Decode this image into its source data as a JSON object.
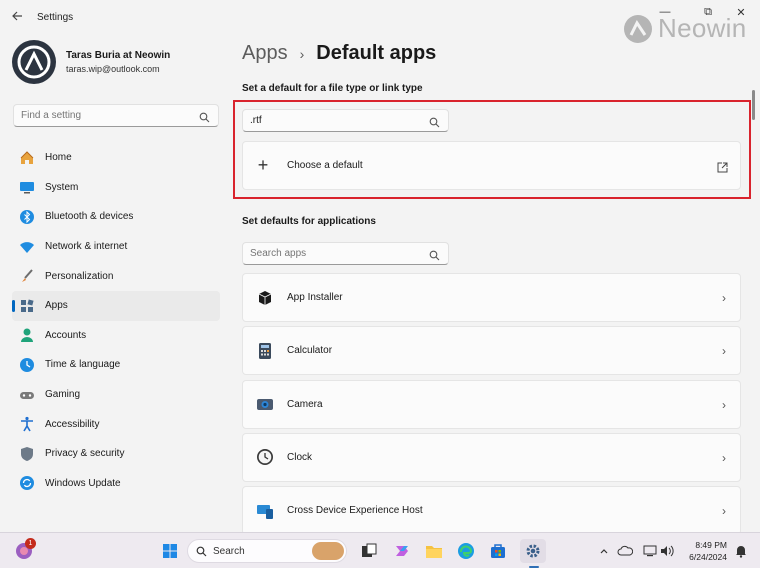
{
  "window": {
    "title": "Settings",
    "back_icon": "back-arrow-icon",
    "minimize": "—",
    "maximize": "⧉",
    "close": "✕"
  },
  "watermark": {
    "text": "Neowin",
    "icon": "neowin-logo-icon"
  },
  "profile": {
    "name": "Taras Buria at Neowin",
    "email": "taras.wip@outlook.com"
  },
  "sidebar": {
    "search_placeholder": "Find a setting",
    "items": [
      {
        "label": "Home",
        "icon": "home-icon",
        "active": false
      },
      {
        "label": "System",
        "icon": "system-icon",
        "active": false
      },
      {
        "label": "Bluetooth & devices",
        "icon": "bluetooth-icon",
        "active": false
      },
      {
        "label": "Network & internet",
        "icon": "network-icon",
        "active": false
      },
      {
        "label": "Personalization",
        "icon": "brush-icon",
        "active": false
      },
      {
        "label": "Apps",
        "icon": "apps-icon",
        "active": true
      },
      {
        "label": "Accounts",
        "icon": "accounts-icon",
        "active": false
      },
      {
        "label": "Time & language",
        "icon": "time-language-icon",
        "active": false
      },
      {
        "label": "Gaming",
        "icon": "gaming-icon",
        "active": false
      },
      {
        "label": "Accessibility",
        "icon": "accessibility-icon",
        "active": false
      },
      {
        "label": "Privacy & security",
        "icon": "shield-icon",
        "active": false
      },
      {
        "label": "Windows Update",
        "icon": "update-icon",
        "active": false
      }
    ]
  },
  "main": {
    "breadcrumb_parent": "Apps",
    "breadcrumb_current": "Default apps",
    "file_type_section": "Set a default for a file type or link type",
    "file_type_value": ".rtf",
    "choose_default_label": "Choose a default",
    "apps_section": "Set defaults for applications",
    "apps_search_placeholder": "Search apps",
    "apps": [
      {
        "label": "App Installer",
        "icon": "app-installer-icon"
      },
      {
        "label": "Calculator",
        "icon": "calculator-icon"
      },
      {
        "label": "Camera",
        "icon": "camera-icon"
      },
      {
        "label": "Clock",
        "icon": "clock-icon"
      },
      {
        "label": "Cross Device Experience Host",
        "icon": "cross-device-icon"
      }
    ]
  },
  "taskbar": {
    "search_label": "Search",
    "notification_count": "1",
    "time": "8:49 PM",
    "date": "6/24/2024"
  },
  "colors": {
    "accent": "#0067c0",
    "highlight_box": "#d9232d",
    "window_bg": "#f3f3f3",
    "card_bg": "#fbfbfb"
  }
}
